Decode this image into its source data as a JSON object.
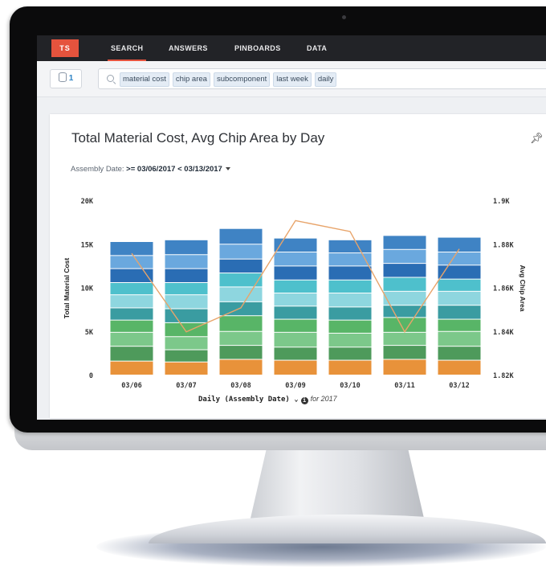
{
  "nav": {
    "logo": "TS",
    "items": [
      "SEARCH",
      "ANSWERS",
      "PINBOARDS",
      "DATA"
    ],
    "active": "SEARCH"
  },
  "searchbar": {
    "source_count": "1",
    "tokens": [
      "material cost",
      "chip area",
      "subcomponent",
      "last week",
      "daily"
    ]
  },
  "card": {
    "title": "Total Material Cost, Avg Chip Area by Day",
    "filter_label": "Assembly Date:",
    "filter_value": ">= 03/06/2017 < 03/13/2017",
    "x_axis_label": "Daily (Assembly Date)",
    "x_axis_suffix": "for 2017",
    "icons": [
      "pin-icon",
      "info-icon",
      "database-icon",
      "search-icon"
    ]
  },
  "chart_data": {
    "type": "bar",
    "stacked": true,
    "categories": [
      "03/06",
      "03/07",
      "03/08",
      "03/09",
      "03/10",
      "03/11",
      "03/12"
    ],
    "ylabel": "Total Material Cost",
    "y2label": "Avg Chip Area",
    "ylim": [
      0,
      20000
    ],
    "y2lim": [
      1820,
      1900
    ],
    "y_ticks": [
      "0",
      "5K",
      "10K",
      "15K",
      "20K"
    ],
    "y2_ticks": [
      "1.82K",
      "1.84K",
      "1.86K",
      "1.88K",
      "1.9K"
    ],
    "colors": [
      "#e8923a",
      "#4e9a5b",
      "#7cc88a",
      "#58b567",
      "#3a9ca1",
      "#8ed6df",
      "#4ec0cc",
      "#2a6db4",
      "#6aa8de",
      "#3f83c4"
    ],
    "series": [
      {
        "values": [
          1600,
          1500,
          1800,
          1700,
          1700,
          1800,
          1700
        ]
      },
      {
        "values": [
          1700,
          1400,
          1600,
          1500,
          1500,
          1600,
          1600
        ]
      },
      {
        "values": [
          1600,
          1500,
          1600,
          1700,
          1600,
          1500,
          1700
        ]
      },
      {
        "values": [
          1400,
          1600,
          1800,
          1500,
          1500,
          1700,
          1400
        ]
      },
      {
        "values": [
          1400,
          1600,
          1600,
          1500,
          1500,
          1400,
          1600
        ]
      },
      {
        "values": [
          1500,
          1600,
          1700,
          1500,
          1600,
          1600,
          1600
        ]
      },
      {
        "values": [
          1400,
          1400,
          1600,
          1500,
          1500,
          1600,
          1400
        ]
      },
      {
        "values": [
          1600,
          1600,
          1600,
          1600,
          1600,
          1600,
          1600
        ]
      },
      {
        "values": [
          1500,
          1600,
          1700,
          1600,
          1500,
          1600,
          1500
        ]
      },
      {
        "values": [
          1600,
          1700,
          1800,
          1600,
          1500,
          1600,
          1700
        ]
      }
    ],
    "line": {
      "color": "#e8a46a",
      "values": [
        1876,
        1840,
        1851,
        1891,
        1886,
        1840,
        1878
      ]
    }
  }
}
